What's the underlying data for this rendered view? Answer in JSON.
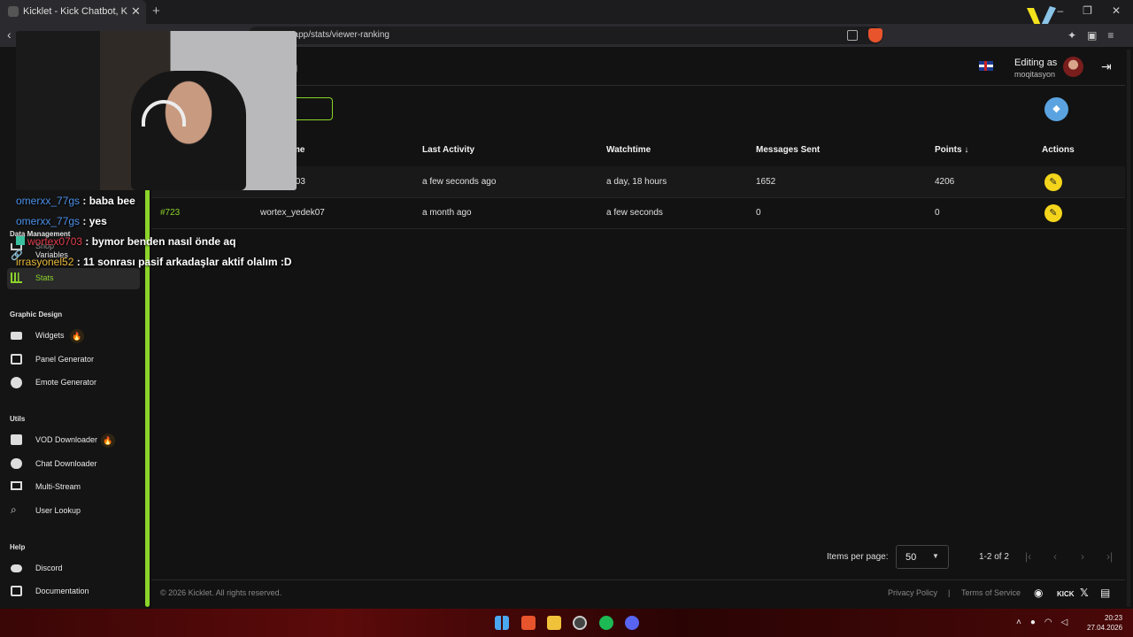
{
  "browser": {
    "tab_title": "Kicklet - Kick Chatbot, Kick Widg",
    "url": "t.app/stats/viewer-ranking"
  },
  "sidebar": {
    "partial_item": "Shop",
    "sections": [
      {
        "label": "Data Management"
      },
      {
        "label": "Graphic Design"
      },
      {
        "label": "Utils"
      },
      {
        "label": "Help"
      }
    ],
    "items": [
      {
        "label": "Variables"
      },
      {
        "label": "Stats"
      },
      {
        "label": "Widgets",
        "badge": "🔥"
      },
      {
        "label": "Panel Generator"
      },
      {
        "label": "Emote Generator"
      },
      {
        "label": "VOD Downloader",
        "badge": "🔥"
      },
      {
        "label": "Chat Downloader"
      },
      {
        "label": "Multi-Stream"
      },
      {
        "label": "User Lookup"
      },
      {
        "label": "Discord"
      },
      {
        "label": "Documentation"
      }
    ]
  },
  "header": {
    "page_title": "g",
    "editing_label": "Editing as",
    "editing_user": "moqitasyon"
  },
  "table": {
    "columns": [
      "me",
      "Last Activity",
      "Watchtime",
      "Messages Sent",
      "Points ↓",
      "Actions"
    ],
    "rows": [
      {
        "rank": "",
        "name": "/03",
        "last_activity": "a few seconds ago",
        "watchtime": "a day, 18 hours",
        "messages": "1652",
        "points": "4206"
      },
      {
        "rank": "#723",
        "name": "wortex_yedek07",
        "last_activity": "a month ago",
        "watchtime": "a few seconds",
        "messages": "0",
        "points": "0"
      }
    ]
  },
  "pagination": {
    "items_per_page_label": "Items per page:",
    "items_per_page_value": "50",
    "range": "1-2 of 2"
  },
  "footer": {
    "copyright": "© 2026 Kicklet. All rights reserved.",
    "privacy": "Privacy Policy",
    "separator": "|",
    "terms": "Terms of Service",
    "kick": "KICK"
  },
  "chat": [
    {
      "user": "omerxx_77gs",
      "message": ": baba bee",
      "color": "#4a8fe8"
    },
    {
      "user": "omerxx_77gs",
      "message": ": yes",
      "color": "#4a8fe8"
    },
    {
      "user": "wortex0703",
      "message": ": bymor benden nasıl önde aq",
      "color": "#e03a4a"
    },
    {
      "user": "irrasyonel52",
      "message": ": 11 sonrası pasif arkadaşlar aktif olalım :D",
      "color": "#e8b83a"
    }
  ],
  "clock": {
    "time": "20:23",
    "date": "27.04.2026"
  },
  "colors": {
    "accent": "#8bd42a",
    "edit": "#f4d51c",
    "clear": "#5aa3e0"
  }
}
